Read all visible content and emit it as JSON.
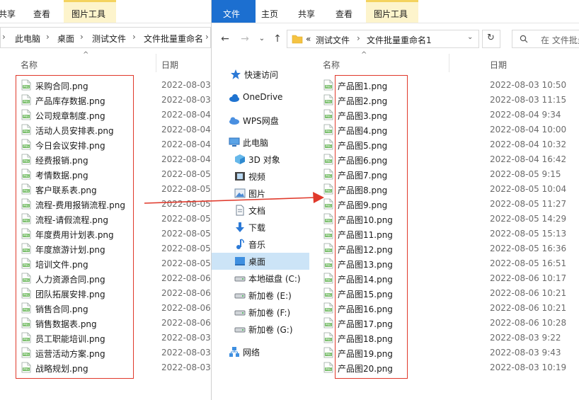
{
  "left_window": {
    "ribbon_tabs": [
      "共享",
      "查看",
      "图片工具"
    ],
    "breadcrumb": [
      "此电脑",
      "桌面",
      "测试文件",
      "文件批量重命名"
    ],
    "columns": {
      "name": "名称",
      "date": "日期"
    },
    "files": [
      {
        "name": "采购合同.png",
        "date": "2022-08-03"
      },
      {
        "name": "产品库存数据.png",
        "date": "2022-08-03"
      },
      {
        "name": "公司规章制度.png",
        "date": "2022-08-04"
      },
      {
        "name": "活动人员安排表.png",
        "date": "2022-08-04"
      },
      {
        "name": "今日会议安排.png",
        "date": "2022-08-04"
      },
      {
        "name": "经费报销.png",
        "date": "2022-08-04"
      },
      {
        "name": "考情数据.png",
        "date": "2022-08-05"
      },
      {
        "name": "客户联系表.png",
        "date": "2022-08-05"
      },
      {
        "name": "流程-费用报销流程.png",
        "date": "2022-08-05"
      },
      {
        "name": "流程-请假流程.png",
        "date": "2022-08-05"
      },
      {
        "name": "年度费用计划表.png",
        "date": "2022-08-05"
      },
      {
        "name": "年度旅游计划.png",
        "date": "2022-08-05"
      },
      {
        "name": "培训文件.png",
        "date": "2022-08-05"
      },
      {
        "name": "人力资源合同.png",
        "date": "2022-08-06"
      },
      {
        "name": "团队拓展安排.png",
        "date": "2022-08-06"
      },
      {
        "name": "销售合同.png",
        "date": "2022-08-06"
      },
      {
        "name": "销售数据表.png",
        "date": "2022-08-06"
      },
      {
        "name": "员工职能培训.png",
        "date": "2022-08-03"
      },
      {
        "name": "运营活动方案.png",
        "date": "2022-08-03"
      },
      {
        "name": "战略规划.png",
        "date": "2022-08-03"
      }
    ]
  },
  "right_window": {
    "ribbon_tabs": [
      "文件",
      "主页",
      "共享",
      "查看",
      "图片工具"
    ],
    "address_prefix": "«",
    "breadcrumb": [
      "测试文件",
      "文件批量重命名1"
    ],
    "search_placeholder": "在 文件批量",
    "nav_items": [
      {
        "label": "快速访问",
        "icon": "star-icon"
      },
      {
        "label": "OneDrive",
        "icon": "cloud-icon"
      },
      {
        "label": "WPS网盘",
        "icon": "wps-cloud-icon"
      },
      {
        "label": "此电脑",
        "icon": "computer-icon"
      },
      {
        "label": "3D 对象",
        "icon": "cube-icon"
      },
      {
        "label": "视频",
        "icon": "video-icon"
      },
      {
        "label": "图片",
        "icon": "picture-icon"
      },
      {
        "label": "文档",
        "icon": "document-icon"
      },
      {
        "label": "下载",
        "icon": "download-icon"
      },
      {
        "label": "音乐",
        "icon": "music-icon"
      },
      {
        "label": "桌面",
        "icon": "desktop-icon",
        "selected": true
      },
      {
        "label": "本地磁盘 (C:)",
        "icon": "drive-icon"
      },
      {
        "label": "新加卷 (E:)",
        "icon": "drive-icon"
      },
      {
        "label": "新加卷 (F:)",
        "icon": "drive-icon"
      },
      {
        "label": "新加卷 (G:)",
        "icon": "drive-icon"
      },
      {
        "label": "网络",
        "icon": "network-icon"
      }
    ],
    "columns": {
      "name": "名称",
      "date": "日期"
    },
    "files": [
      {
        "name": "产品图1.png",
        "date": "2022-08-03 10:50"
      },
      {
        "name": "产品图2.png",
        "date": "2022-08-03 11:15"
      },
      {
        "name": "产品图3.png",
        "date": "2022-08-04 9:34"
      },
      {
        "name": "产品图4.png",
        "date": "2022-08-04 10:00"
      },
      {
        "name": "产品图5.png",
        "date": "2022-08-04 10:32"
      },
      {
        "name": "产品图6.png",
        "date": "2022-08-04 16:42"
      },
      {
        "name": "产品图7.png",
        "date": "2022-08-05 9:15"
      },
      {
        "name": "产品图8.png",
        "date": "2022-08-05 10:04"
      },
      {
        "name": "产品图9.png",
        "date": "2022-08-05 11:27"
      },
      {
        "name": "产品图10.png",
        "date": "2022-08-05 14:29"
      },
      {
        "name": "产品图11.png",
        "date": "2022-08-05 15:13"
      },
      {
        "name": "产品图12.png",
        "date": "2022-08-05 16:36"
      },
      {
        "name": "产品图13.png",
        "date": "2022-08-05 16:51"
      },
      {
        "name": "产品图14.png",
        "date": "2022-08-06 10:17"
      },
      {
        "name": "产品图15.png",
        "date": "2022-08-06 10:21"
      },
      {
        "name": "产品图16.png",
        "date": "2022-08-06 10:21"
      },
      {
        "name": "产品图17.png",
        "date": "2022-08-06 10:28"
      },
      {
        "name": "产品图18.png",
        "date": "2022-08-03 9:22"
      },
      {
        "name": "产品图19.png",
        "date": "2022-08-03 9:43"
      },
      {
        "name": "产品图20.png",
        "date": "2022-08-03 10:19"
      }
    ]
  },
  "colors": {
    "highlight_box": "#e0392b",
    "arrow": "#e0392b",
    "file_tab": "#1c6fd0",
    "picture_tools_tab": "#fdf4cc",
    "nav_selected": "#cce4f7"
  }
}
